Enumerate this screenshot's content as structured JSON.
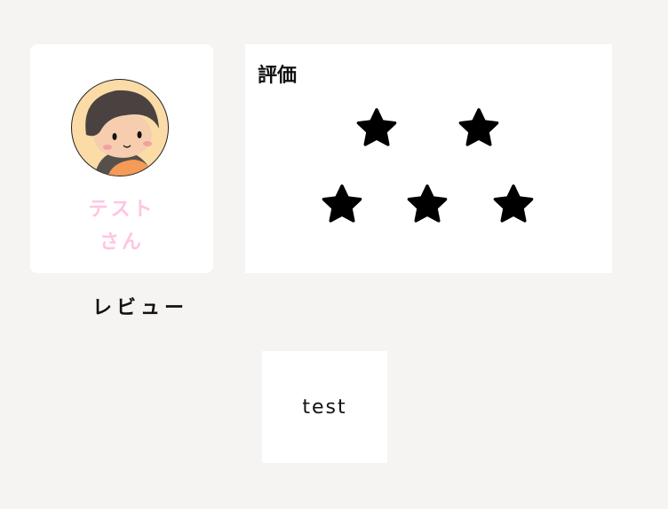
{
  "profile": {
    "name_line1": "テスト",
    "name_line2": "さん"
  },
  "rating": {
    "title": "評価",
    "value": 5,
    "max": 5,
    "star_color": "#000000"
  },
  "review": {
    "title": "レビュー",
    "text": "test"
  }
}
